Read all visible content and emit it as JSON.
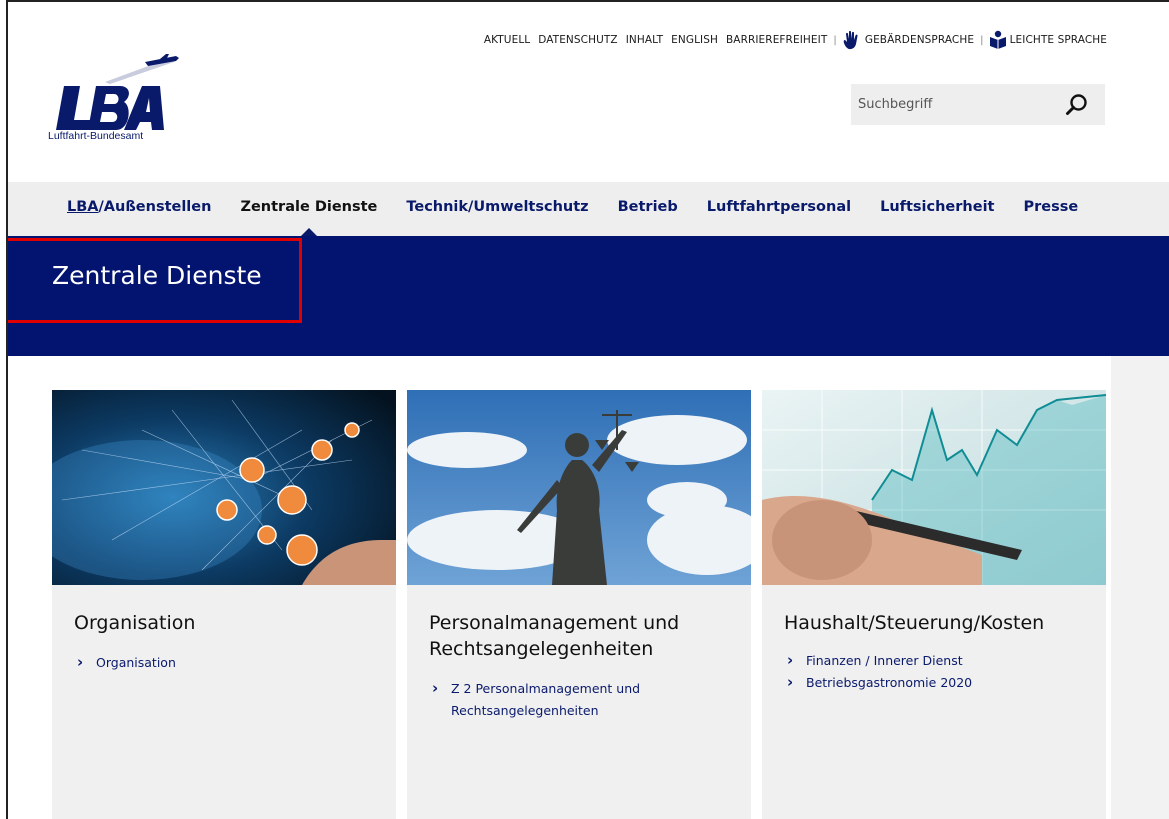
{
  "meta_nav": [
    {
      "label": "AKTUELL",
      "icon": null
    },
    {
      "label": "DATENSCHUTZ",
      "icon": null
    },
    {
      "label": "INHALT",
      "icon": null
    },
    {
      "label": "ENGLISH",
      "icon": null
    },
    {
      "label": "BARRIEREFREIHEIT",
      "icon": null
    },
    {
      "label": "GEBÄRDENSPRACHE",
      "icon": "hand-icon"
    },
    {
      "label": "LEICHTE SPRACHE",
      "icon": "easy-language-icon"
    }
  ],
  "logo": {
    "subtitle": "Luftfahrt-Bundesamt",
    "brand_color": "#0a1a6b"
  },
  "search": {
    "placeholder": "Suchbegriff"
  },
  "main_nav": [
    {
      "label": "LBA/Außenstellen",
      "active": false
    },
    {
      "label": "Zentrale Dienste",
      "active": true
    },
    {
      "label": "Technik/Umweltschutz",
      "active": false
    },
    {
      "label": "Betrieb",
      "active": false
    },
    {
      "label": "Luftfahrtpersonal",
      "active": false
    },
    {
      "label": "Luftsicherheit",
      "active": false
    },
    {
      "label": "Presse",
      "active": false
    }
  ],
  "hero": {
    "title": "Zentrale Dienste",
    "background": "#021470"
  },
  "cards": [
    {
      "title": "Organisation",
      "image": "network-people-image",
      "links": [
        "Organisation"
      ]
    },
    {
      "title": "Personalmanagement und Rechtsangelegenheiten",
      "image": "justitia-statue-image",
      "links": [
        "Z 2 Personalmanagement und Rechtsangelegenheiten"
      ]
    },
    {
      "title": "Haushalt/Steuerung/Kosten",
      "image": "financial-chart-image",
      "links": [
        "Finanzen / Innerer Dienst",
        "Betriebsgastronomie 2020"
      ]
    }
  ],
  "colors": {
    "accent": "#0a1a6b",
    "highlight": "#e00000"
  }
}
